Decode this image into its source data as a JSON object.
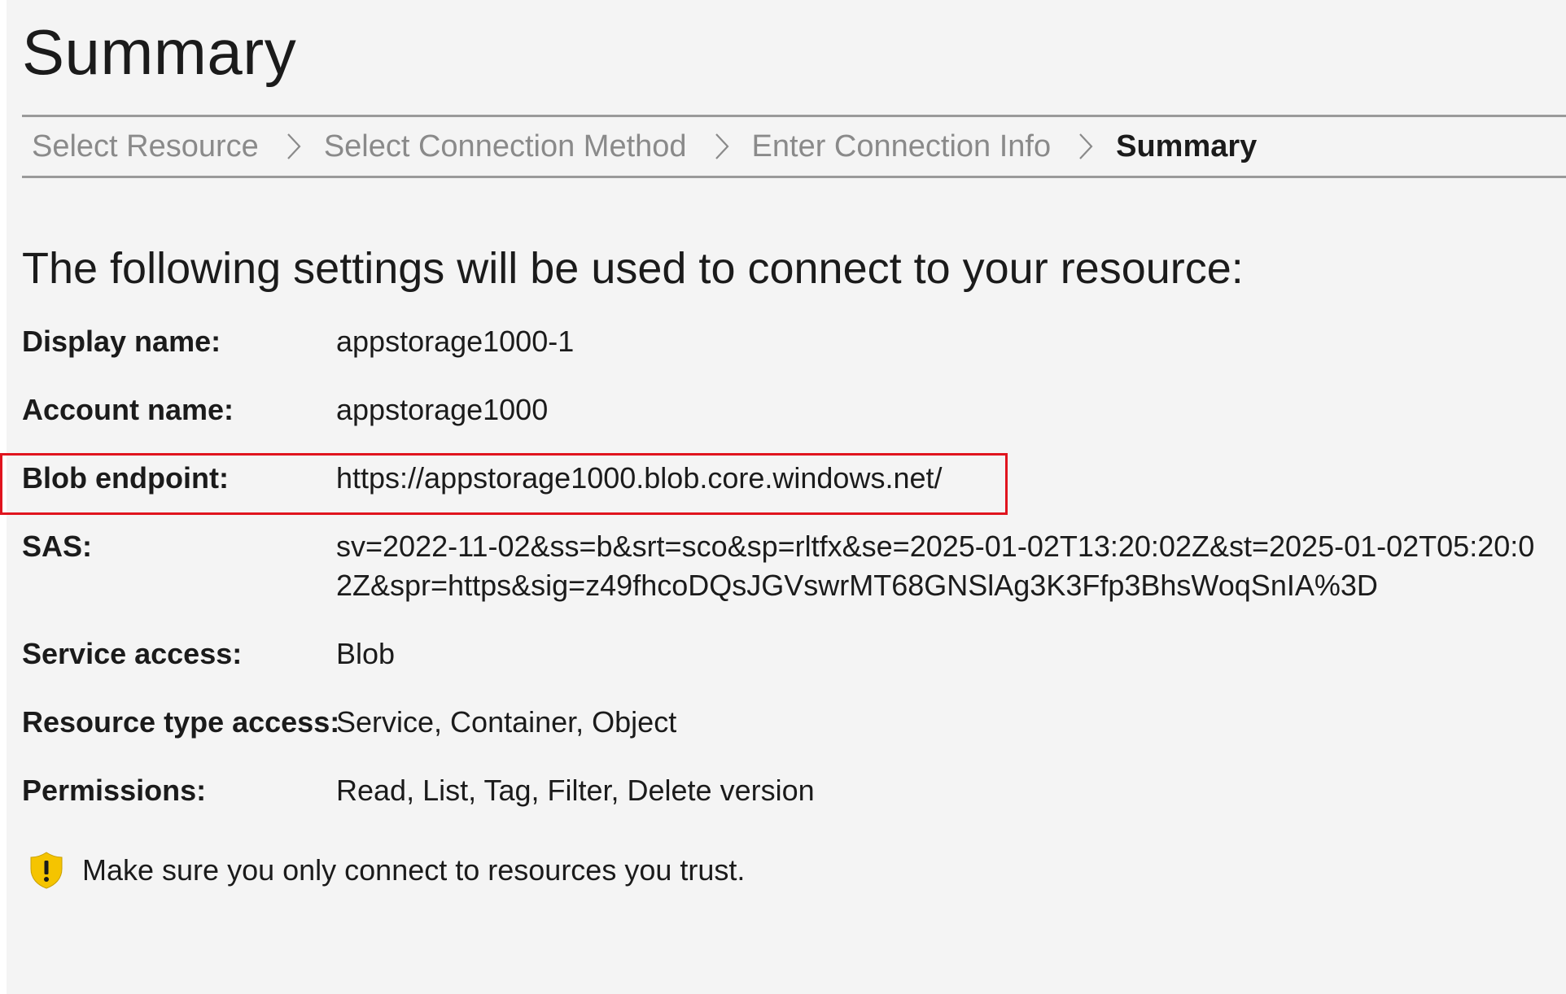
{
  "header": {
    "title": "Summary"
  },
  "breadcrumb": {
    "steps": [
      {
        "label": "Select Resource",
        "active": false
      },
      {
        "label": "Select Connection Method",
        "active": false
      },
      {
        "label": "Enter Connection Info",
        "active": false
      },
      {
        "label": "Summary",
        "active": true
      }
    ]
  },
  "main": {
    "intro": "The following settings will be used to connect to your resource:",
    "settings": [
      {
        "label": "Display name:",
        "value": "appstorage1000-1"
      },
      {
        "label": "Account name:",
        "value": "appstorage1000"
      },
      {
        "label": "Blob endpoint:",
        "value": "https://appstorage1000.blob.core.windows.net/"
      },
      {
        "label": "SAS:",
        "value": "sv=2022-11-02&ss=b&srt=sco&sp=rltfx&se=2025-01-02T13:20:02Z&st=2025-01-02T05:20:02Z&spr=https&sig=z49fhcoDQsJGVswrMT68GNSlAg3K3Ffp3BhsWoqSnIA%3D"
      },
      {
        "label": "Service access:",
        "value": "Blob"
      },
      {
        "label": "Resource type access:",
        "value": "Service, Container, Object"
      },
      {
        "label": "Permissions:",
        "value": "Read, List, Tag, Filter, Delete version"
      }
    ],
    "warning": {
      "icon": "shield-warning-icon",
      "text": "Make sure you only connect to resources you trust."
    }
  },
  "colors": {
    "panel_background": "#f4f4f4",
    "highlight_border": "#e0141e",
    "shield_fill": "#f5c400",
    "inactive_crumb": "#8a8a8a"
  }
}
